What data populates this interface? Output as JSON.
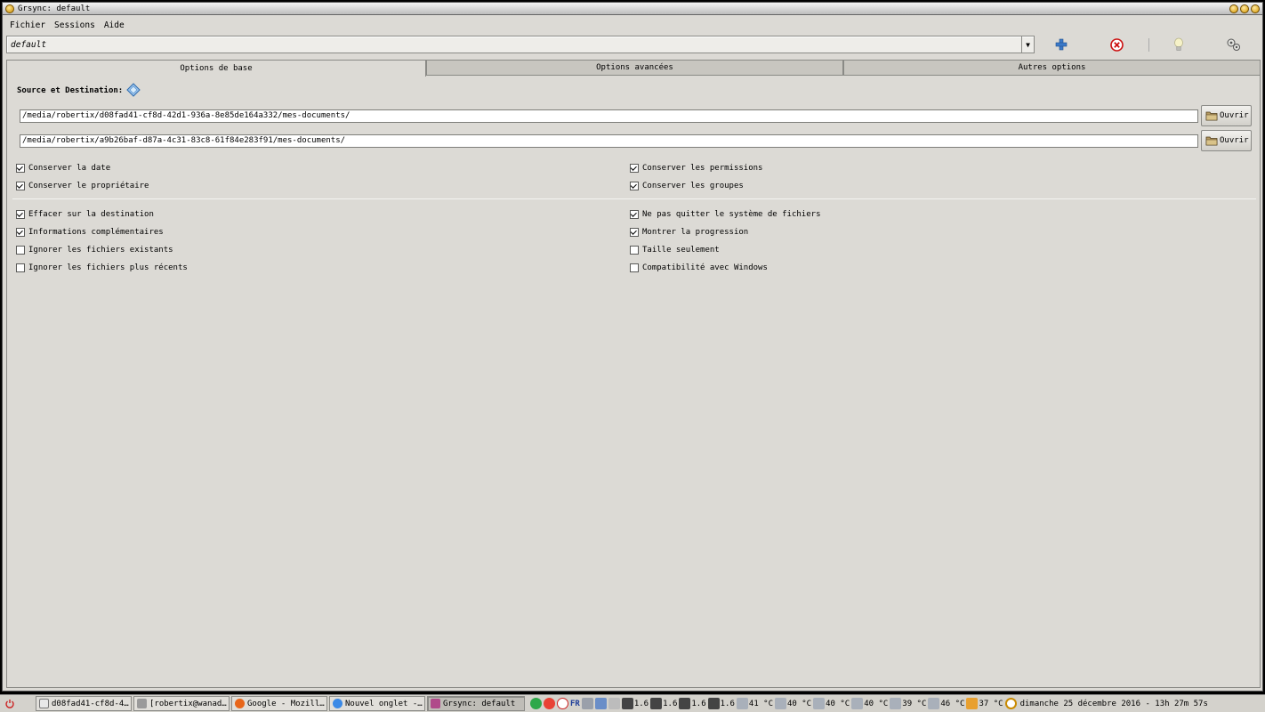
{
  "window": {
    "title": "Grsync: default"
  },
  "menu": {
    "items": [
      "Fichier",
      "Sessions",
      "Aide"
    ]
  },
  "session": {
    "value": "default"
  },
  "tabs": [
    "Options de base",
    "Options avancées",
    "Autres options"
  ],
  "basic": {
    "source_dest_label": "Source et Destination:",
    "source_path": "/media/robertix/d08fad41-cf8d-42d1-936a-8e85de164a332/mes-documents/",
    "dest_path": "/media/robertix/a9b26baf-d87a-4c31-83c8-61f84e283f91/mes-documents/",
    "open_label": "Ouvrir",
    "options": [
      {
        "label": "Conserver la date",
        "checked": true
      },
      {
        "label": "Conserver les permissions",
        "checked": true
      },
      {
        "label": "Conserver le propriétaire",
        "checked": true
      },
      {
        "label": "Conserver les groupes",
        "checked": true
      },
      {
        "label": "Effacer sur la destination",
        "checked": true
      },
      {
        "label": "Ne pas quitter le système de fichiers",
        "checked": true
      },
      {
        "label": "Informations complémentaires",
        "checked": true
      },
      {
        "label": "Montrer la progression",
        "checked": true
      },
      {
        "label": "Ignorer les fichiers existants",
        "checked": false
      },
      {
        "label": "Taille seulement",
        "checked": false
      },
      {
        "label": "Ignorer les fichiers plus récents",
        "checked": false
      },
      {
        "label": "Compatibilité avec Windows",
        "checked": false
      }
    ]
  },
  "taskbar": {
    "tasks": [
      {
        "label": "d08fad41-cf8d-4…",
        "color": "#e8e8e8"
      },
      {
        "label": "[robertix@wanad…",
        "color": "#9a9a9a"
      },
      {
        "label": "Google - Mozill…",
        "color": "#e8661a"
      },
      {
        "label": "Nouvel onglet -…",
        "color": "#3c8ae6"
      },
      {
        "label": "Grsync: default",
        "color": "#b04a8a"
      }
    ],
    "lang": "FR",
    "cpu": [
      "1.6",
      "1.6",
      "1.6",
      "1.6"
    ],
    "temps": [
      "41 °C",
      "40 °C",
      "40 °C",
      "40 °C",
      "39 °C",
      "46 °C",
      "37 °C"
    ],
    "clock": "dimanche 25 décembre 2016 - 13h 27m 57s"
  }
}
